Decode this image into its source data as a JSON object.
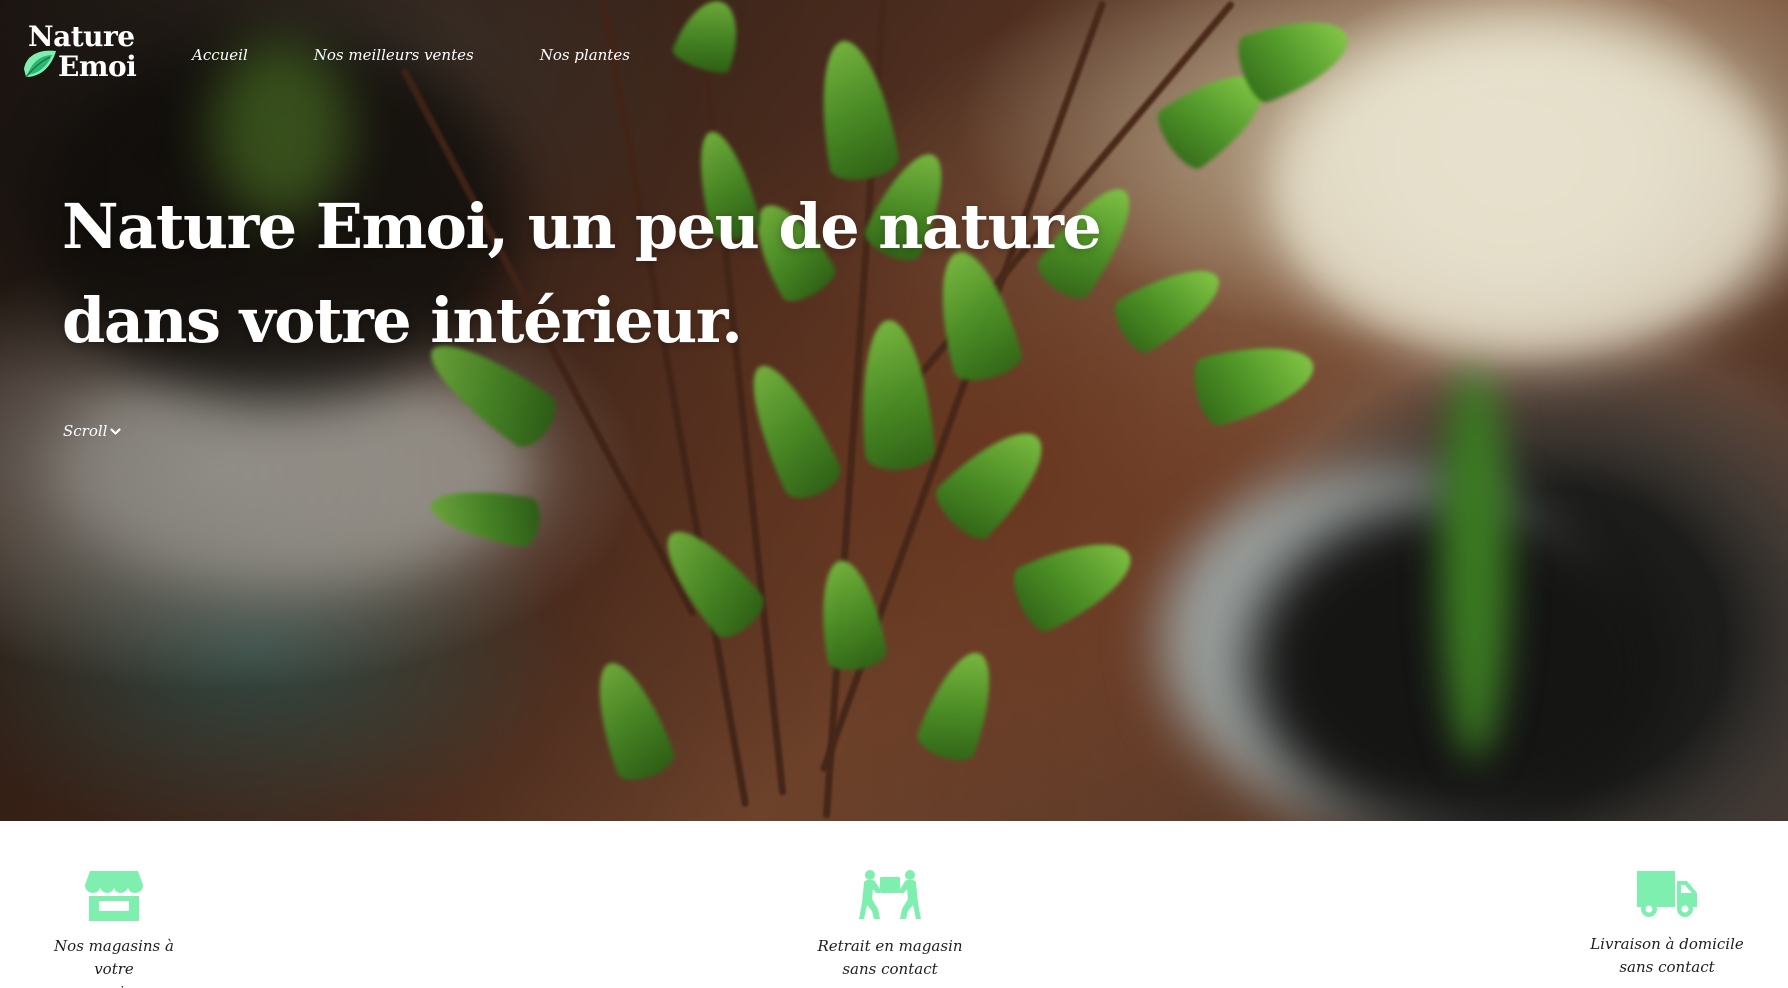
{
  "brand": {
    "logo_line1": "Nature",
    "logo_line2": "Emoi",
    "accent_color": "#7fefb0",
    "leaf_colors": [
      "#2bb673",
      "#7fefb0"
    ]
  },
  "nav": {
    "items": [
      {
        "label": "Accueil"
      },
      {
        "label": "Nos meilleurs ventes"
      },
      {
        "label": "Nos plantes"
      }
    ]
  },
  "hero": {
    "headline_line1": "Nature Emoi, un peu de nature",
    "headline_line2": "dans votre intérieur.",
    "scroll_label": "Scroll",
    "scroll_icon": "chevron-down-icon"
  },
  "services": [
    {
      "icon": "store-icon",
      "line1": "Nos magasins à votre",
      "line2": "service"
    },
    {
      "icon": "people-carry-icon",
      "line1": "Retrait en magasin",
      "line2": "sans contact"
    },
    {
      "icon": "truck-icon",
      "line1": "Livraison à domicile",
      "line2": "sans contact"
    }
  ]
}
